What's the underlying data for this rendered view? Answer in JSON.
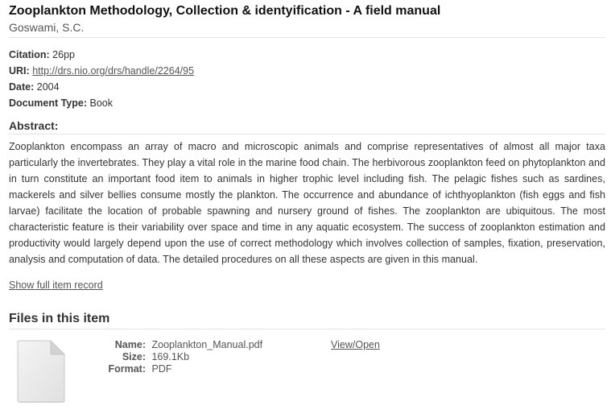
{
  "item": {
    "title": "Zooplankton Methodology, Collection & identyification - A field manual",
    "author": "Goswami, S.C."
  },
  "metadata": {
    "citation_label": "Citation:",
    "citation_value": "26pp",
    "uri_label": "URI:",
    "uri_value": "http://drs.nio.org/drs/handle/2264/95",
    "date_label": "Date:",
    "date_value": "2004",
    "doctype_label": "Document Type:",
    "doctype_value": "Book"
  },
  "abstract": {
    "heading": "Abstract:",
    "text": "Zooplankton encompass an array of macro and microscopic animals and comprise representatives of almost all major taxa particularly the invertebrates. They play a vital role in the marine food chain. The herbivorous zooplankton feed on phytoplankton and in turn constitute an important food item to animals in higher trophic level including fish. The pelagic fishes such as sardines, mackerels and silver bellies consume mostly the plankton. The occurrence and abundance of ichthyoplankton (fish eggs and fish larvae) facilitate the location of probable spawning and nursery ground of fishes. The zooplankton are ubiquitous. The most characteristic feature is their variability over space and time in any aquatic ecosystem. The success of zooplankton estimation and productivity would largely depend upon the use of correct methodology which involves collection of samples, fixation, preservation, analysis and computation of data. The detailed procedures on all these aspects are given in this manual."
  },
  "links": {
    "full_record": "Show full item record"
  },
  "files": {
    "heading": "Files in this item",
    "items": [
      {
        "icon": "file-document-icon",
        "name_label": "Name:",
        "name_value": "Zooplankton_Manual.pdf",
        "size_label": "Size:",
        "size_value": "169.1Kb",
        "format_label": "Format:",
        "format_value": "PDF",
        "action_label": "View/Open"
      }
    ]
  },
  "colors": {
    "text": "#333333",
    "link": "#555555",
    "divider": "#e3e3e3"
  }
}
